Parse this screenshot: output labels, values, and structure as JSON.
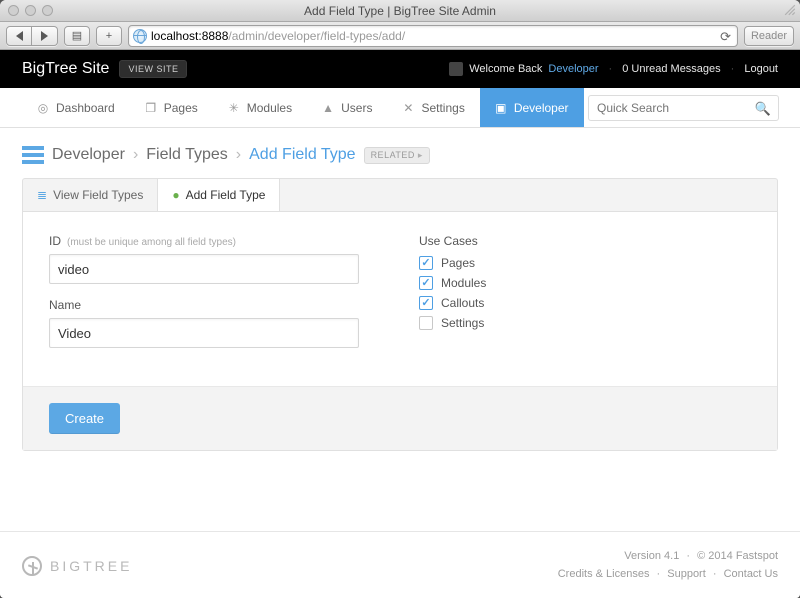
{
  "window": {
    "title": "Add Field Type | BigTree Site Admin"
  },
  "url": {
    "host": "localhost:8888",
    "path": "/admin/developer/field-types/add/"
  },
  "reader_label": "Reader",
  "header": {
    "brand": "BigTree Site",
    "view_site": "VIEW SITE",
    "welcome": "Welcome Back",
    "user": "Developer",
    "unread": "0 Unread Messages",
    "logout": "Logout"
  },
  "nav": {
    "items": [
      {
        "label": "Dashboard",
        "icon": "◎"
      },
      {
        "label": "Pages",
        "icon": "❐"
      },
      {
        "label": "Modules",
        "icon": "✳"
      },
      {
        "label": "Users",
        "icon": "▲"
      },
      {
        "label": "Settings",
        "icon": "✕"
      },
      {
        "label": "Developer",
        "icon": "▣",
        "active": true
      }
    ],
    "search_placeholder": "Quick Search"
  },
  "breadcrumb": {
    "a": "Developer",
    "b": "Field Types",
    "c": "Add Field Type",
    "related": "RELATED"
  },
  "tabs": {
    "view": "View Field Types",
    "add": "Add Field Type"
  },
  "form": {
    "id_label": "ID",
    "id_hint": "(must be unique among all field types)",
    "id_value": "video",
    "name_label": "Name",
    "name_value": "Video",
    "use_cases_label": "Use Cases",
    "use_cases": [
      {
        "label": "Pages",
        "checked": true
      },
      {
        "label": "Modules",
        "checked": true
      },
      {
        "label": "Callouts",
        "checked": true
      },
      {
        "label": "Settings",
        "checked": false
      }
    ],
    "submit": "Create"
  },
  "footer": {
    "logo": "BIGTREE",
    "version": "Version 4.1",
    "copyright": "© 2014 Fastspot",
    "links": [
      "Credits & Licenses",
      "Support",
      "Contact Us"
    ]
  }
}
